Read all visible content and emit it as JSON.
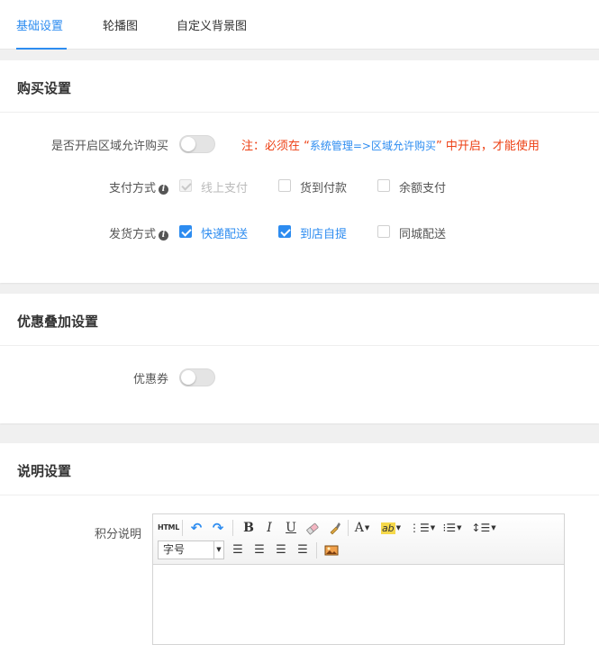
{
  "tabs": [
    {
      "label": "基础设置",
      "active": true
    },
    {
      "label": "轮播图",
      "active": false
    },
    {
      "label": "自定义背景图",
      "active": false
    }
  ],
  "purchase": {
    "title": "购买设置",
    "region_label": "是否开启区域允许购买",
    "region_enabled": false,
    "note_prefix": "注：必须在 “",
    "note_link": "系统管理=>区域允许购买",
    "note_suffix": "” 中开启，才能使用",
    "payment": {
      "label": "支付方式",
      "options": [
        {
          "label": "线上支付",
          "checked": true,
          "disabled": true
        },
        {
          "label": "货到付款",
          "checked": false,
          "disabled": false
        },
        {
          "label": "余额支付",
          "checked": false,
          "disabled": false
        }
      ]
    },
    "delivery": {
      "label": "发货方式",
      "options": [
        {
          "label": "快递配送",
          "checked": true,
          "disabled": false
        },
        {
          "label": "到店自提",
          "checked": true,
          "disabled": false
        },
        {
          "label": "同城配送",
          "checked": false,
          "disabled": false
        }
      ]
    }
  },
  "discount": {
    "title": "优惠叠加设置",
    "coupon_label": "优惠券",
    "coupon_enabled": false
  },
  "description": {
    "title": "说明设置",
    "points_label": "积分说明",
    "editor": {
      "html_label": "HTML",
      "font_size_value": "字号",
      "content": ""
    }
  },
  "colors": {
    "accent": "#2d8cf0",
    "warning": "#ed4014"
  }
}
